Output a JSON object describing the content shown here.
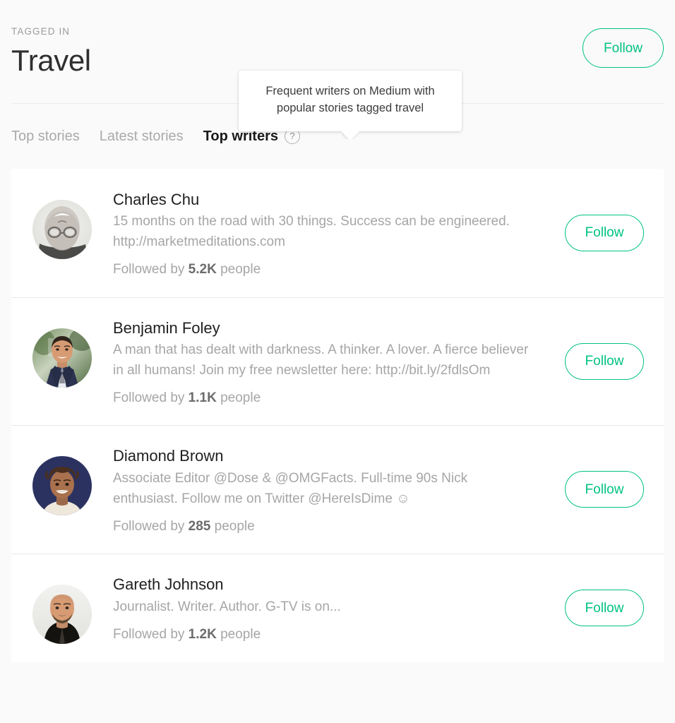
{
  "header": {
    "eyebrow": "TAGGED IN",
    "title": "Travel",
    "follow_label": "Follow"
  },
  "tooltip": {
    "text": "Frequent writers on Medium with popular stories tagged travel"
  },
  "tabs": [
    {
      "label": "Top stories",
      "active": false
    },
    {
      "label": "Latest stories",
      "active": false
    },
    {
      "label": "Top writers",
      "active": true
    }
  ],
  "help_icon_glyph": "?",
  "colors": {
    "accent_green": "#00c281",
    "page_background": "#fafafa",
    "card_background": "#ffffff",
    "muted_text": "#a6a6a6",
    "title_text": "#1f1f1f"
  },
  "writers": [
    {
      "name": "Charles Chu",
      "bio": "15 months on the road with 30 things. Success can be engineered. http://marketmeditations.com",
      "followed_prefix": "Followed by",
      "followers": "5.2K",
      "followed_suffix": "people",
      "follow_label": "Follow",
      "avatar": "charles-chu-avatar"
    },
    {
      "name": "Benjamin Foley",
      "bio": "A man that has dealt with darkness. A thinker. A lover. A fierce believer in all humans! Join my free newsletter here: http://bit.ly/2fdlsOm",
      "followed_prefix": "Followed by",
      "followers": "1.1K",
      "followed_suffix": "people",
      "follow_label": "Follow",
      "avatar": "benjamin-foley-avatar"
    },
    {
      "name": "Diamond Brown",
      "bio": "Associate Editor @Dose & @OMGFacts. Full-time 90s Nick enthusiast. Follow me on Twitter @HereIsDime ☺",
      "followed_prefix": "Followed by",
      "followers": "285",
      "followed_suffix": "people",
      "follow_label": "Follow",
      "avatar": "diamond-brown-avatar"
    },
    {
      "name": "Gareth Johnson",
      "bio": "Journalist. Writer. Author. G-TV is on...",
      "followed_prefix": "Followed by",
      "followers": "1.2K",
      "followed_suffix": "people",
      "follow_label": "Follow",
      "avatar": "gareth-johnson-avatar"
    }
  ]
}
